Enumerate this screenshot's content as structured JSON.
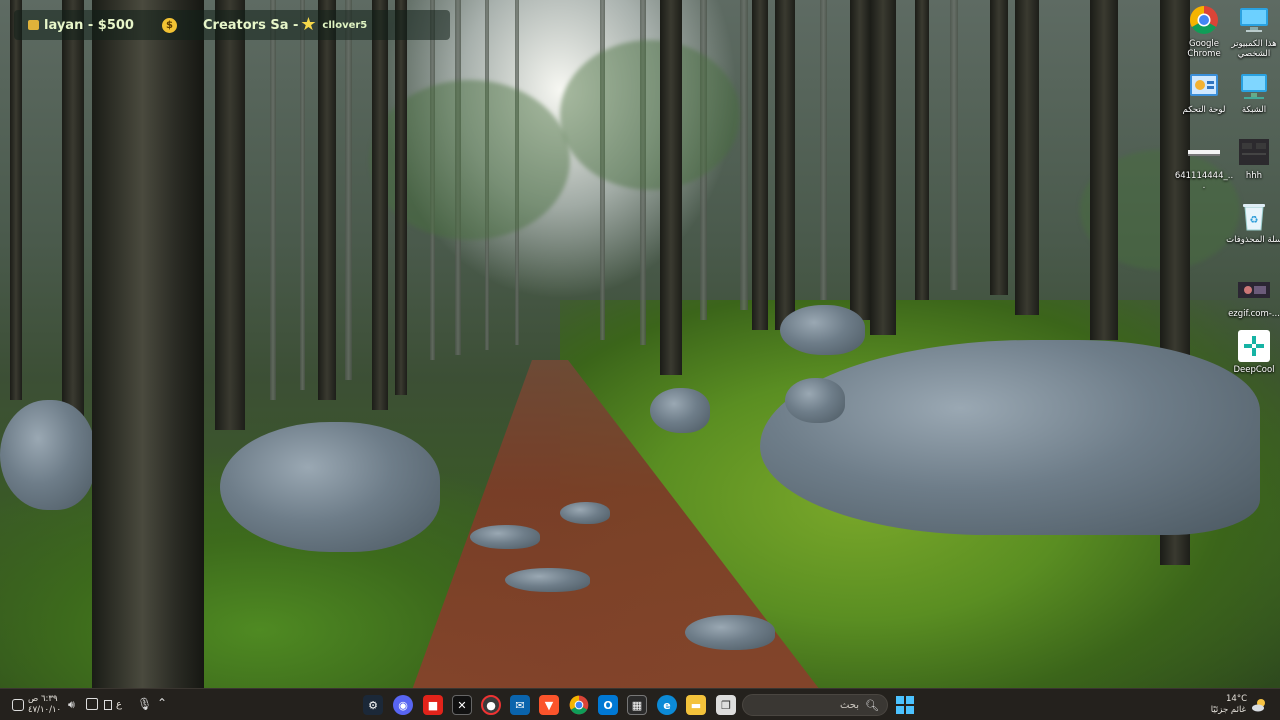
{
  "widgets": {
    "balance": "layan - $500",
    "creator": "Creators Sa -",
    "creator_user": "cllover5"
  },
  "desktop_icons": [
    {
      "label": "Google Chrome",
      "icon": "chrome-icon"
    },
    {
      "label": "هذا الكمبيوتر الشخصي",
      "icon": "this-pc-icon"
    },
    {
      "label": "لوحة التحكم",
      "icon": "control-panel-icon"
    },
    {
      "label": "الشبكة",
      "icon": "network-icon"
    },
    {
      "label": "641114444_...",
      "icon": "file-icon"
    },
    {
      "label": "hhh",
      "icon": "folder-icon"
    },
    {
      "label": "سلة المحذوفات",
      "icon": "recycle-bin-icon"
    },
    {
      "label": "ezgif.com-...",
      "icon": "image-file-icon"
    },
    {
      "label": "DeepCool",
      "icon": "deepcool-icon"
    }
  ],
  "taskbar": {
    "search_placeholder": "بحث",
    "weather_temp": "14°C",
    "weather_desc": "غائم جزئيًا",
    "time": "٦:٣٩ ص",
    "date": "٤٧/١٠/١٠",
    "lang": "ع",
    "apps": [
      "windows-start",
      "search",
      "file-explorer",
      "edge",
      "store",
      "outlook",
      "chrome",
      "brave",
      "mail",
      "obs",
      "capcut",
      "roblox",
      "discord",
      "steam"
    ]
  },
  "colors": {
    "taskbar_bg": "#24211d",
    "widget_text": "#e7f6c9",
    "coin": "#f2c233"
  }
}
